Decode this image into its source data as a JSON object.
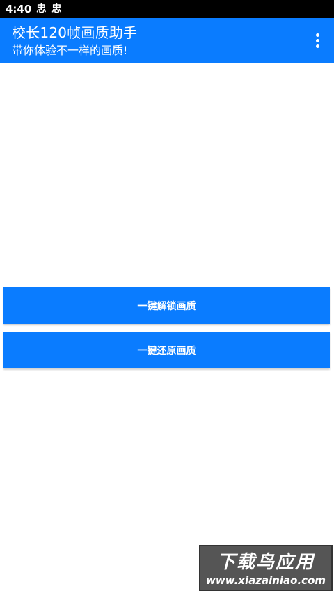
{
  "status_bar": {
    "time": "4:40",
    "notification_icons": [
      "忠",
      "忠"
    ]
  },
  "app_bar": {
    "title": "校长120帧画质助手",
    "subtitle": "带你体验不一样的画质!",
    "menu_icon": "more-vert-icon"
  },
  "buttons": {
    "unlock_label": "一键解锁画质",
    "restore_label": "一键还原画质"
  },
  "watermark": {
    "title": "下载鸟应用",
    "url": "www.xiazainiao.com"
  },
  "colors": {
    "primary": "#0a7cff",
    "status_bar_bg": "#000000",
    "background": "#ffffff",
    "watermark_bg": "#555555"
  }
}
